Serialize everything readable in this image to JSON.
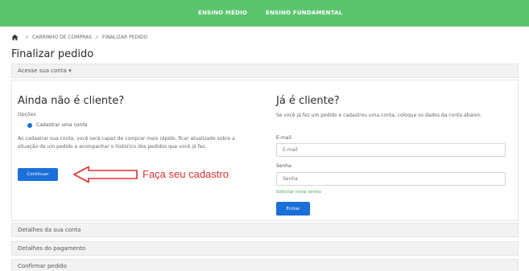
{
  "nav": {
    "item1": "ENSINO MÉDIO",
    "item2": "ENSINO FUNDAMENTAL"
  },
  "breadcrumb": {
    "icon": "home-icon",
    "step1": "CARRINHO DE COMPRAS",
    "step2": "FINALIZAR PEDIDO",
    "separator": ">"
  },
  "page_title": "Finalizar pedido",
  "account_section": {
    "label": "Acesse sua conta ▾"
  },
  "new_customer": {
    "title": "Ainda não é cliente?",
    "options_label": "Opções",
    "radio_label": "Cadastrar uma conta",
    "info": "Ao cadastrar sua conta, você será capaz de comprar mais rápido, ficar atualizado sobre a situação de um pedido e acompanhar o histórico dos pedidos que você já fez.",
    "continue_button": "Continuar",
    "annotation": "Faça seu cadastro"
  },
  "returning_customer": {
    "title": "Já é cliente?",
    "description": "Se você já fez um pedido e cadastrou uma conta, coloque os dados da conta abaixo:",
    "email_label": "E-mail",
    "email_placeholder": "E-mail",
    "password_label": "Senha",
    "password_placeholder": "Senha",
    "forgot_link": "Solicitar nova senha",
    "login_button": "Entrar"
  },
  "sections": {
    "account_details": "Detalhes da sua conta",
    "payment_details": "Detalhes do pagamento",
    "confirm_order": "Confirmar pedido"
  },
  "colors": {
    "header": "#5cc46e",
    "primary_button": "#1b6fd8",
    "annotation": "#e03030",
    "link": "#44a55a"
  }
}
